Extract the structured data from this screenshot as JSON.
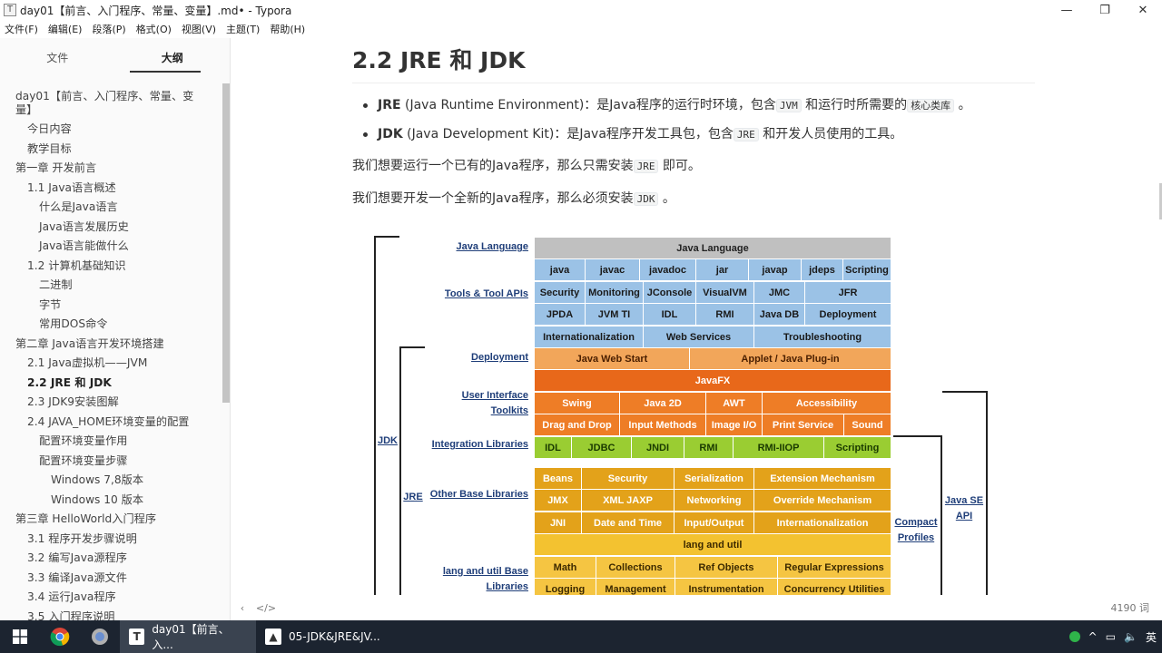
{
  "window": {
    "app_icon": "T",
    "title": "day01【前言、入门程序、常量、变量】.md• - Typora",
    "minimize": "—",
    "restore": "❐",
    "close": "✕"
  },
  "menu": [
    "文件(F)",
    "编辑(E)",
    "段落(P)",
    "格式(O)",
    "视图(V)",
    "主题(T)",
    "帮助(H)"
  ],
  "sidebar": {
    "tabs": [
      "文件",
      "大纲"
    ],
    "outline": [
      {
        "label": "day01【前言、入门程序、常量、变量】",
        "level": 1
      },
      {
        "label": "今日内容",
        "level": 2
      },
      {
        "label": "教学目标",
        "level": 2
      },
      {
        "label": "第一章 开发前言",
        "level": 1
      },
      {
        "label": "1.1 Java语言概述",
        "level": 2
      },
      {
        "label": "什么是Java语言",
        "level": 3
      },
      {
        "label": "Java语言发展历史",
        "level": 3
      },
      {
        "label": "Java语言能做什么",
        "level": 3
      },
      {
        "label": "1.2 计算机基础知识",
        "level": 2
      },
      {
        "label": "二进制",
        "level": 3
      },
      {
        "label": "字节",
        "level": 3
      },
      {
        "label": "常用DOS命令",
        "level": 3
      },
      {
        "label": "第二章 Java语言开发环境搭建",
        "level": 1
      },
      {
        "label": "2.1 Java虚拟机——JVM",
        "level": 2
      },
      {
        "label": "2.2 JRE 和 JDK",
        "level": 2,
        "active": true
      },
      {
        "label": "2.3 JDK9安装图解",
        "level": 2
      },
      {
        "label": "2.4 JAVA_HOME环境变量的配置",
        "level": 2
      },
      {
        "label": "配置环境变量作用",
        "level": 3
      },
      {
        "label": "配置环境变量步骤",
        "level": 3
      },
      {
        "label": "Windows 7,8版本",
        "level": 4
      },
      {
        "label": "Windows 10 版本",
        "level": 4
      },
      {
        "label": "第三章 HelloWorld入门程序",
        "level": 1
      },
      {
        "label": "3.1 程序开发步骤说明",
        "level": 2
      },
      {
        "label": "3.2 编写Java源程序",
        "level": 2
      },
      {
        "label": "3.3 编译Java源文件",
        "level": 2
      },
      {
        "label": "3.4 运行Java程序",
        "level": 2
      },
      {
        "label": "3.5 入门程序说明",
        "level": 2
      }
    ]
  },
  "doc": {
    "heading": "2.2 JRE 和 JDK",
    "jre_term": "JRE",
    "jre_text_1": " (Java Runtime Environment)：是Java程序的运行时环境，包含",
    "jre_code_1": "JVM",
    "jre_text_2": " 和运行时所需要的",
    "jre_code_2": "核心类库",
    "jre_text_3": " 。",
    "jdk_term": "JDK",
    "jdk_text_1": " (Java Development Kit)：是Java程序开发工具包，包含",
    "jdk_code": "JRE",
    "jdk_text_2": " 和开发人员使用的工具。",
    "p1_text": "我们想要运行一个已有的Java程序，那么只需安装",
    "p1_code": "JRE",
    "p1_end": " 即可。",
    "p2_text": "我们想要开发一个全新的Java程序，那么必须安装",
    "p2_code": "JDK",
    "p2_end": " 。"
  },
  "diagram": {
    "row_labels": [
      "Java Language",
      "Tools & Tool APIs",
      "Deployment",
      "User Interface Toolkits",
      "Integration Libraries",
      "Other Base Libraries",
      "lang and util Base Libraries"
    ],
    "brackets": [
      "JDK",
      "JRE",
      "Compact Profiles",
      "Java SE API"
    ],
    "cells": [
      {
        "text": "Java Language",
        "style": "c-gray"
      },
      {
        "text": "java",
        "style": "c-blue"
      },
      {
        "text": "javac",
        "style": "c-blue"
      },
      {
        "text": "javadoc",
        "style": "c-blue"
      },
      {
        "text": "jar",
        "style": "c-blue"
      },
      {
        "text": "javap",
        "style": "c-blue"
      },
      {
        "text": "jdeps",
        "style": "c-blue"
      },
      {
        "text": "Scripting",
        "style": "c-blue"
      },
      {
        "text": "Security",
        "style": "c-blue"
      },
      {
        "text": "Monitoring",
        "style": "c-blue"
      },
      {
        "text": "JConsole",
        "style": "c-blue"
      },
      {
        "text": "VisualVM",
        "style": "c-blue"
      },
      {
        "text": "JMC",
        "style": "c-blue"
      },
      {
        "text": "JFR",
        "style": "c-blue"
      },
      {
        "text": "JPDA",
        "style": "c-blue"
      },
      {
        "text": "JVM TI",
        "style": "c-blue"
      },
      {
        "text": "IDL",
        "style": "c-blue"
      },
      {
        "text": "RMI",
        "style": "c-blue"
      },
      {
        "text": "Java DB",
        "style": "c-blue"
      },
      {
        "text": "Deployment",
        "style": "c-blue"
      },
      {
        "text": "Internationalization",
        "style": "c-blue"
      },
      {
        "text": "Web Services",
        "style": "c-blue"
      },
      {
        "text": "Troubleshooting",
        "style": "c-blue"
      },
      {
        "text": "Java Web Start",
        "style": "c-orange1"
      },
      {
        "text": "Applet / Java Plug-in",
        "style": "c-orange1"
      },
      {
        "text": "JavaFX",
        "style": "c-orange3"
      },
      {
        "text": "Swing",
        "style": "c-orange2"
      },
      {
        "text": "Java 2D",
        "style": "c-orange2"
      },
      {
        "text": "AWT",
        "style": "c-orange2"
      },
      {
        "text": "Accessibility",
        "style": "c-orange2"
      },
      {
        "text": "Drag and Drop",
        "style": "c-orange2"
      },
      {
        "text": "Input Methods",
        "style": "c-orange2"
      },
      {
        "text": "Image I/O",
        "style": "c-orange2"
      },
      {
        "text": "Print Service",
        "style": "c-orange2"
      },
      {
        "text": "Sound",
        "style": "c-orange2"
      },
      {
        "text": "IDL",
        "style": "c-green"
      },
      {
        "text": "JDBC",
        "style": "c-green"
      },
      {
        "text": "JNDI",
        "style": "c-green"
      },
      {
        "text": "RMI",
        "style": "c-green"
      },
      {
        "text": "RMI-IIOP",
        "style": "c-green"
      },
      {
        "text": "Scripting",
        "style": "c-green"
      },
      {
        "text": "Beans",
        "style": "c-gold1"
      },
      {
        "text": "Security",
        "style": "c-gold1"
      },
      {
        "text": "Serialization",
        "style": "c-gold1"
      },
      {
        "text": "Extension Mechanism",
        "style": "c-gold1"
      },
      {
        "text": "JMX",
        "style": "c-gold1"
      },
      {
        "text": "XML JAXP",
        "style": "c-gold1"
      },
      {
        "text": "Networking",
        "style": "c-gold1"
      },
      {
        "text": "Override Mechanism",
        "style": "c-gold1"
      },
      {
        "text": "JNI",
        "style": "c-gold1"
      },
      {
        "text": "Date and Time",
        "style": "c-gold1"
      },
      {
        "text": "Input/Output",
        "style": "c-gold1"
      },
      {
        "text": "Internationalization",
        "style": "c-gold1"
      },
      {
        "text": "lang and util",
        "style": "c-gold2"
      },
      {
        "text": "Math",
        "style": "c-gold3"
      },
      {
        "text": "Collections",
        "style": "c-gold3"
      },
      {
        "text": "Ref Objects",
        "style": "c-gold3"
      },
      {
        "text": "Regular Expressions",
        "style": "c-gold3"
      },
      {
        "text": "Logging",
        "style": "c-gold3"
      },
      {
        "text": "Management",
        "style": "c-gold3"
      },
      {
        "text": "Instrumentation",
        "style": "c-gold3"
      },
      {
        "text": "Concurrency Utilities",
        "style": "c-gold3"
      }
    ]
  },
  "footer": {
    "back": "‹",
    "source": "</>",
    "word_count": "4190 词"
  },
  "taskbar": {
    "start": "⊞",
    "apps": [
      {
        "label": "day01【前言、入...",
        "icon": "T",
        "active": true
      },
      {
        "label": "05-JDK&JRE&JV...",
        "icon": "▲",
        "active": false
      }
    ],
    "ime": "英"
  }
}
